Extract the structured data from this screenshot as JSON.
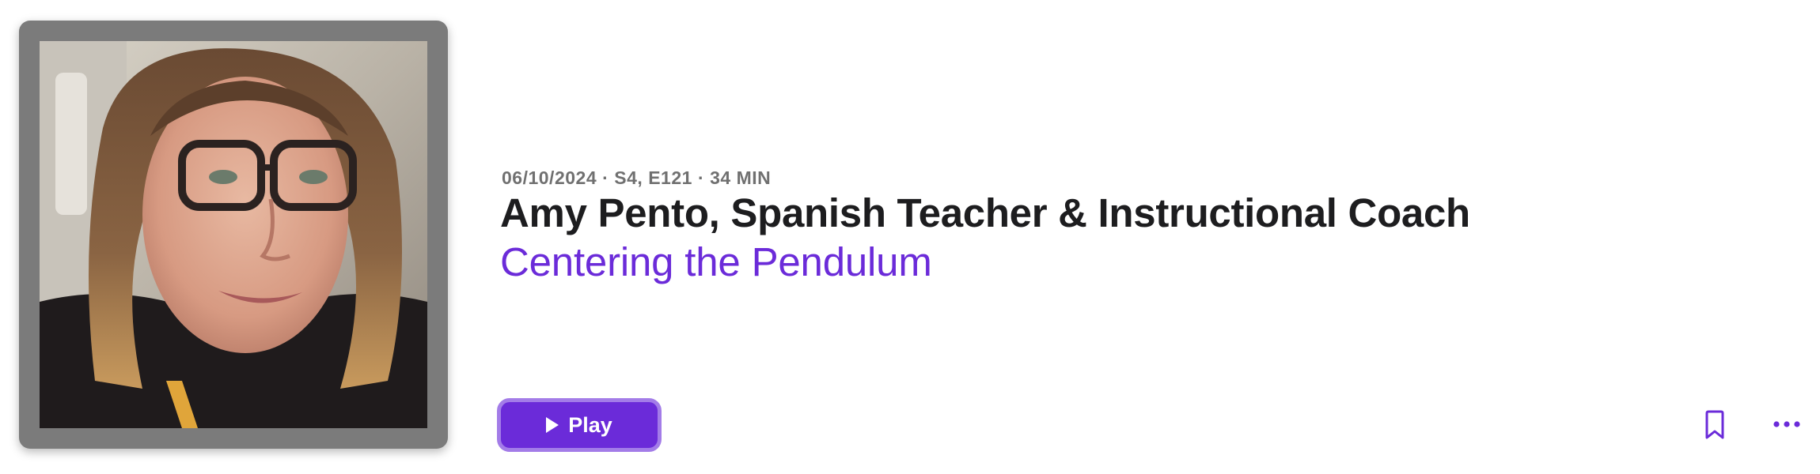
{
  "episode": {
    "date": "06/10/2024",
    "season_episode": "S4, E121",
    "duration": "34 MIN",
    "separator": "·",
    "title": "Amy Pento, Spanish Teacher & Instructional Coach",
    "show_title": "Centering the Pendulum"
  },
  "actions": {
    "play_label": "Play",
    "bookmark_icon": "bookmark-icon",
    "more_icon": "ellipsis-icon"
  },
  "colors": {
    "accent": "#6b2bd9",
    "accent_border": "#a37ce8",
    "title_text": "#1d1d1f",
    "meta_text": "#707070",
    "artwork_frame": "#7b7b7b"
  }
}
